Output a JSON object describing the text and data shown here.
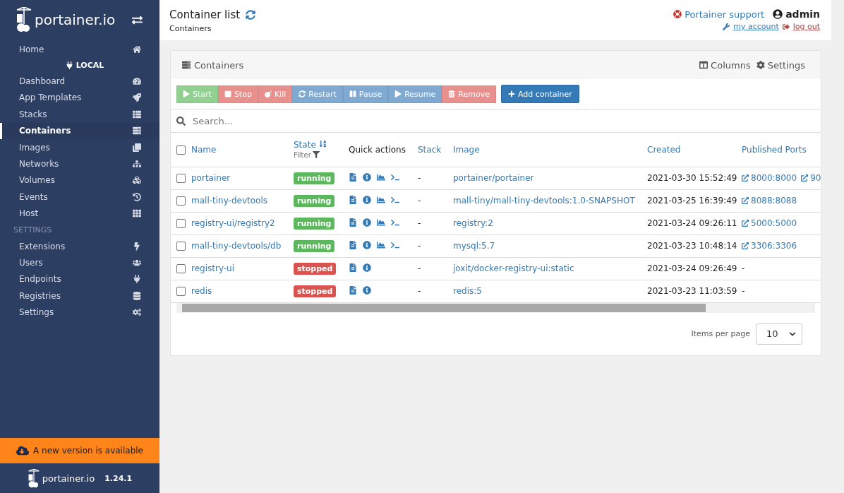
{
  "sidebar": {
    "logo": "portainer.io",
    "items": [
      {
        "label": "Home",
        "kind": "item",
        "selected": false
      },
      {
        "label": "LOCAL",
        "kind": "endpoint"
      },
      {
        "label": "Dashboard",
        "kind": "item",
        "selected": false
      },
      {
        "label": "App Templates",
        "kind": "item",
        "selected": false
      },
      {
        "label": "Stacks",
        "kind": "item",
        "selected": false
      },
      {
        "label": "Containers",
        "kind": "item",
        "selected": true
      },
      {
        "label": "Images",
        "kind": "item",
        "selected": false
      },
      {
        "label": "Networks",
        "kind": "item",
        "selected": false
      },
      {
        "label": "Volumes",
        "kind": "item",
        "selected": false
      },
      {
        "label": "Events",
        "kind": "item",
        "selected": false
      },
      {
        "label": "Host",
        "kind": "item",
        "selected": false
      },
      {
        "label": "SETTINGS",
        "kind": "heading"
      },
      {
        "label": "Extensions",
        "kind": "item",
        "selected": false
      },
      {
        "label": "Users",
        "kind": "item",
        "selected": false
      },
      {
        "label": "Endpoints",
        "kind": "item",
        "selected": false
      },
      {
        "label": "Registries",
        "kind": "item",
        "selected": false
      },
      {
        "label": "Settings",
        "kind": "item",
        "selected": false
      }
    ],
    "update_banner": "A new version is available",
    "footer_logo": "portainer.io",
    "version": "1.24.1"
  },
  "header": {
    "title": "Container list",
    "breadcrumb": "Containers",
    "support": "Portainer support",
    "user": "admin",
    "my_account": "my account",
    "log_out": "log out"
  },
  "panel": {
    "title": "Containers",
    "columns_button": "Columns",
    "settings_button": "Settings",
    "actions": [
      {
        "label": "Start",
        "color": "#91d091",
        "disabled": true
      },
      {
        "label": "Stop",
        "color": "#e8908e",
        "disabled": true
      },
      {
        "label": "Kill",
        "color": "#e8908e",
        "disabled": true
      },
      {
        "label": "Restart",
        "color": "#7fa9d1",
        "disabled": true
      },
      {
        "label": "Pause",
        "color": "#7fa9d1",
        "disabled": true
      },
      {
        "label": "Resume",
        "color": "#7fa9d1",
        "disabled": true
      },
      {
        "label": "Remove",
        "color": "#e8908e",
        "disabled": true
      }
    ],
    "select_all_checked": false,
    "add_button": "Add container",
    "search": {
      "placeholder": "Search..."
    },
    "columns": [
      "Name",
      "State",
      "Quick actions",
      "Stack",
      "Image",
      "Created",
      "Published Ports"
    ],
    "state_filter": "Filter",
    "rows": [
      {
        "name": "portainer",
        "state": "running",
        "color": "#5cb85c",
        "live_actions": true,
        "stack": "-",
        "image": "portainer/portainer",
        "created": "2021-03-30 15:52:49",
        "ports": [
          "8000:8000",
          "90"
        ],
        "checked": false
      },
      {
        "name": "mall-tiny-devtools",
        "state": "running",
        "color": "#5cb85c",
        "live_actions": true,
        "stack": "-",
        "image": "mall-tiny/mall-tiny-devtools:1.0-SNAPSHOT",
        "created": "2021-03-25 16:39:49",
        "ports": [
          "8088:8088"
        ],
        "checked": false
      },
      {
        "name": "registry-ui/registry2",
        "state": "running",
        "color": "#5cb85c",
        "live_actions": true,
        "stack": "-",
        "image": "registry:2",
        "created": "2021-03-24 09:26:11",
        "ports": [
          "5000:5000"
        ],
        "checked": false
      },
      {
        "name": "mall-tiny-devtools/db",
        "state": "running",
        "color": "#5cb85c",
        "live_actions": true,
        "stack": "-",
        "image": "mysql:5.7",
        "created": "2021-03-23 10:48:14",
        "ports": [
          "3306:3306"
        ],
        "checked": false
      },
      {
        "name": "registry-ui",
        "state": "stopped",
        "color": "#d9534f",
        "live_actions": false,
        "stack": "-",
        "image": "joxit/docker-registry-ui:static",
        "created": "2021-03-24 09:26:49",
        "no_ports": "-",
        "checked": false
      },
      {
        "name": "redis",
        "state": "stopped",
        "color": "#d9534f",
        "live_actions": false,
        "stack": "-",
        "image": "redis:5",
        "created": "2021-03-23 11:03:59",
        "no_ports": "-",
        "checked": false
      }
    ],
    "items_per_page_label": "Items per page",
    "items_per_page": "10"
  }
}
